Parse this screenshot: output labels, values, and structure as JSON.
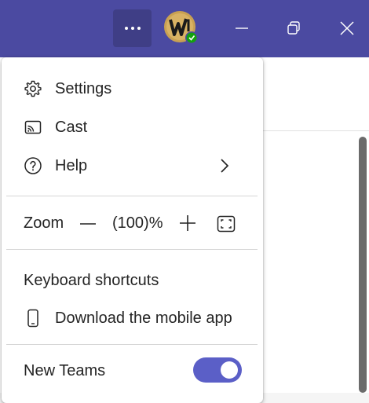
{
  "titlebar": {
    "more_button_label": "More options",
    "accent_color": "#4b4aa1",
    "avatar_status": "available"
  },
  "menu": {
    "settings": {
      "label": "Settings",
      "icon": "gear-icon"
    },
    "cast": {
      "label": "Cast",
      "icon": "cast-icon"
    },
    "help": {
      "label": "Help",
      "icon": "help-circle-icon",
      "has_submenu": true
    },
    "zoom": {
      "label": "Zoom",
      "value": "(100)%"
    },
    "keyboard_shortcuts": {
      "label": "Keyboard shortcuts"
    },
    "download_mobile": {
      "label": "Download the mobile app",
      "icon": "phone-icon"
    },
    "new_teams": {
      "label": "New Teams",
      "toggle_on": true,
      "toggle_color": "#5b5fc7"
    }
  }
}
